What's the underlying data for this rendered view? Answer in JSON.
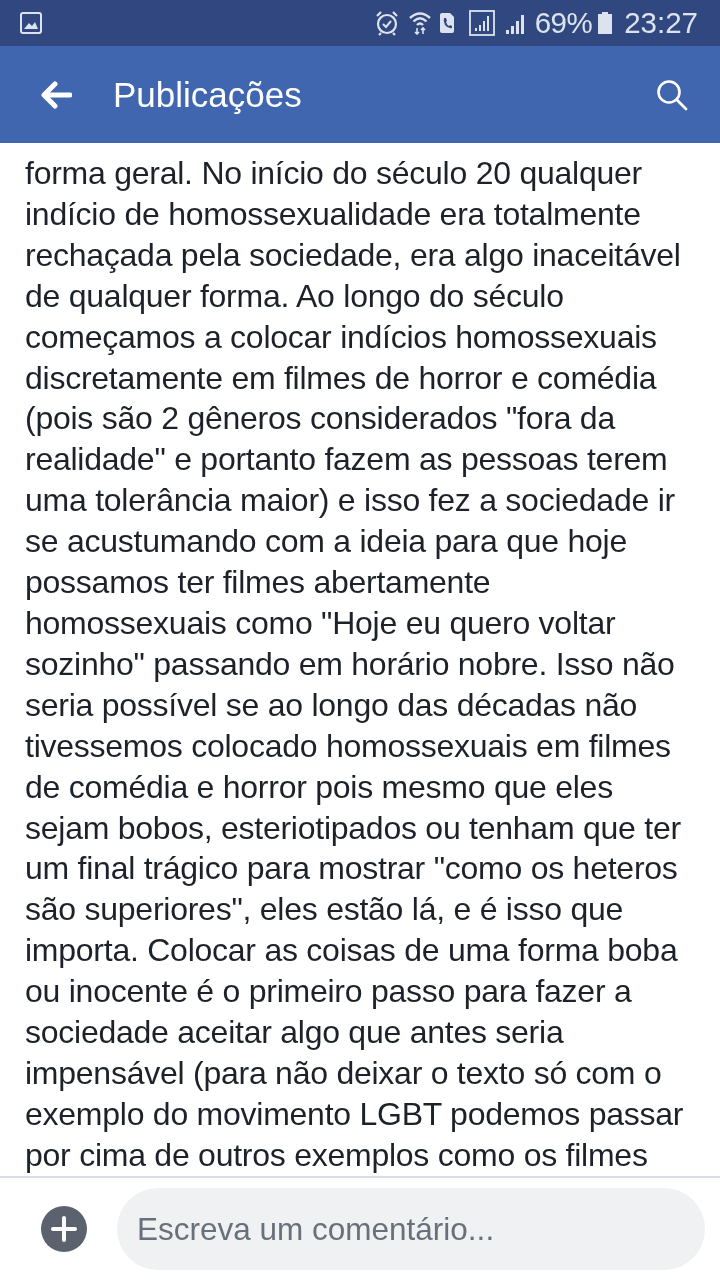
{
  "status_bar": {
    "battery": "69%",
    "time": "23:27"
  },
  "header": {
    "title": "Publicações"
  },
  "post": {
    "lines": [
      "forma geral. No início do século 20 qualquer",
      "indício de homossexualidade era totalmente",
      "rechaçada pela sociedade, era algo inaceitável",
      "de qualquer forma. Ao longo do século",
      "começamos a colocar indícios homossexuais",
      "discretamente em filmes de horror e comédia",
      "(pois são 2 gêneros considerados \"fora da",
      "realidade\" e portanto fazem as pessoas terem",
      "uma tolerância maior) e isso fez a sociedade ir",
      "se acustumando com a ideia para que hoje",
      "possamos ter filmes abertamente",
      "homossexuais como \"Hoje eu quero voltar",
      "sozinho\" passando em horário nobre. Isso não",
      "seria possível se ao longo das décadas não",
      "tivessemos colocado homossexuais em filmes",
      "de comédia e horror pois mesmo que eles",
      "sejam bobos, esteriotipados ou tenham que ter",
      "um final trágico para mostrar \"como os heteros",
      "são superiores\", eles estão lá, e é isso que",
      "importa. Colocar as coisas de uma forma boba",
      "ou inocente é o primeiro passo para fazer a",
      "sociedade aceitar algo que antes seria",
      "impensável (para não deixar o texto só com o",
      "exemplo do movimento LGBT podemos passar",
      "por cima de outros exemplos como os filmes"
    ]
  },
  "composer": {
    "placeholder": "Escreva um comentário..."
  }
}
